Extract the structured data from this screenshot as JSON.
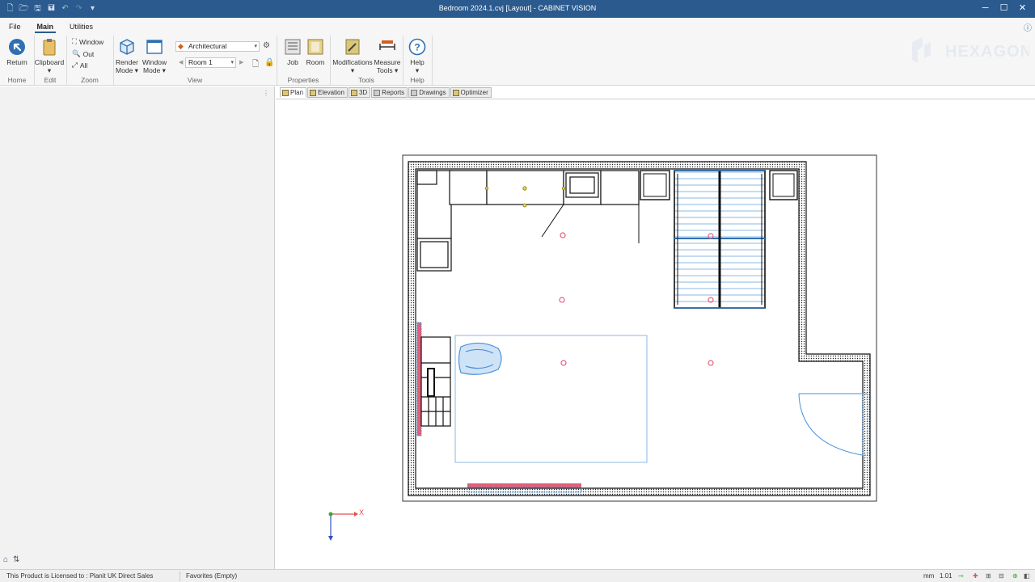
{
  "window": {
    "title": "Bedroom 2024.1.cvj [Layout] - CABINET VISION",
    "controls": [
      "─",
      "☐",
      "✕"
    ]
  },
  "ribbon": {
    "tabs": [
      "File",
      "Main",
      "Utilities"
    ],
    "active_tab": "Main",
    "home": {
      "return_label": "Return",
      "group": "Home"
    },
    "edit": {
      "clipboard_label": "Clipboard",
      "group": "Edit"
    },
    "zoom": {
      "window_label": "Window",
      "out_label": "Out",
      "all_label": "All",
      "group": "Zoom"
    },
    "view": {
      "render_mode_label": "Render\nMode",
      "window_mode_label": "Window\nMode",
      "units_select": "Architectural",
      "room_select": "Room 1",
      "group": "View"
    },
    "properties": {
      "job_label": "Job",
      "room_label": "Room",
      "group": "Properties"
    },
    "tools": {
      "modifications_label": "Modifications",
      "measure_tools_label": "Measure\nTools",
      "group": "Tools"
    },
    "help": {
      "help_label": "Help",
      "group": "Help"
    }
  },
  "brand": {
    "logo_text": "HEXAGON",
    "accent": "#2a5a8e"
  },
  "view_tabs": [
    "Plan",
    "Elevation",
    "3D",
    "Reports",
    "Drawings",
    "Optimizer"
  ],
  "active_view_tab": "Plan",
  "plan": {
    "axis_x_label": "X",
    "wall_color": "#111111",
    "accent_red": "#e0607a",
    "accent_blue": "#4a90d9",
    "pin_color": "#e0607a",
    "ceiling_light_color": "#b8a400"
  },
  "statusbar": {
    "license_text": "This Product is Licensed to : Planit UK Direct Sales",
    "favorites_text": "Favorites (Empty)",
    "units": "mm",
    "zoom": "1.01"
  }
}
